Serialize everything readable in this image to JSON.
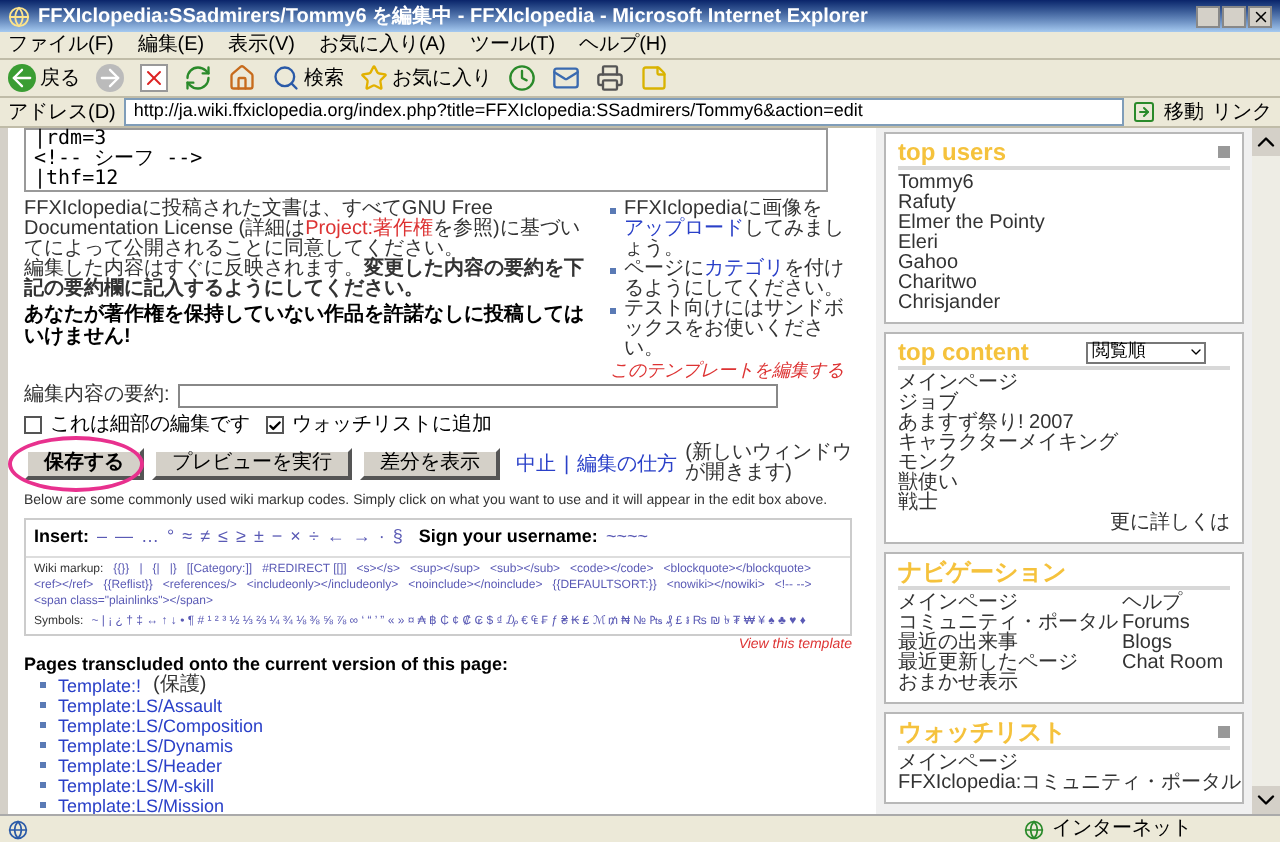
{
  "window": {
    "title": "FFXIclopedia:SSadmirers/Tommy6 を編集中 - FFXIclopedia - Microsoft Internet Explorer"
  },
  "menu": [
    "ファイル(F)",
    "編集(E)",
    "表示(V)",
    "お気に入り(A)",
    "ツール(T)",
    "ヘルプ(H)"
  ],
  "toolbar": {
    "back": "戻る",
    "search": "検索",
    "favorites": "お気に入り"
  },
  "address_bar": {
    "label": "アドレス(D)",
    "url": "http://ja.wiki.ffxiclopedia.org/index.php?title=FFXIclopedia:SSadmirers/Tommy6&action=edit",
    "go": "移動",
    "links": "リンク"
  },
  "editor": {
    "lines": [
      "|rdm=3",
      "<!-- シーフ -->",
      "|thf=12"
    ]
  },
  "notice": {
    "license_before": "FFXIclopediaに投稿された文書は、すべてGNU Free Documentation License (詳細は",
    "license_link": "Project:著作権",
    "license_after": "を参照)に基づいてによって公開されることに同意してください。",
    "publish": "編集した内容はすぐに反映されます。**変更した内容の要約を下記の要約欄に記入するようにしてください。**",
    "warning": "あなたが著作権を保持していない作品を許諾なしに投稿してはいけません!"
  },
  "tips": [
    {
      "before": "FFXIclopediaに画像を",
      "link": "アップロード",
      "after": "してみましょう。"
    },
    {
      "before": "ページに",
      "link": "カテゴリ",
      "after": "を付けるようにしてください。"
    },
    {
      "before": "テスト向けにはサンドボックスをお使いください。"
    }
  ],
  "edit_template_link": "このテンプレートを編集する",
  "summary": {
    "label": "編集内容の要約:"
  },
  "checkboxes": [
    {
      "label": "これは細部の編集です",
      "checked": false
    },
    {
      "label": "ウォッチリストに追加",
      "checked": true
    }
  ],
  "buttons": [
    {
      "label": "保存する",
      "highlighted": true
    },
    {
      "label": "プレビューを実行",
      "highlighted": false
    },
    {
      "label": "差分を表示",
      "highlighted": false
    }
  ],
  "edit_links": {
    "cancel": "中止",
    "separator": "|",
    "help": "編集の仕方",
    "note": "(新しいウィンドウが開きます)"
  },
  "help_text": "Below are some commonly used wiki markup codes. Simply click on what you want to use and it will appear in the edit box above.",
  "insert": {
    "label": "Insert:",
    "chars": [
      "–",
      "—",
      "…",
      "°",
      "≈",
      "≠",
      "≤",
      "≥",
      "±",
      "−",
      "×",
      "÷",
      "←",
      "→",
      "·",
      "§"
    ],
    "sign_label": "Sign your username:",
    "signature": "~~~~"
  },
  "wiki_markup": {
    "label": "Wiki markup:",
    "items": [
      "{{}}",
      "|",
      "{|",
      "|}",
      "[[Category:]]",
      "#REDIRECT [[]]",
      "<s></s>",
      "<sup></sup>",
      "<sub></sub>",
      "<code></code>",
      "<blockquote></blockquote>",
      "<ref></ref>",
      "{{Reflist}}",
      "<references/>",
      "<includeonly></includeonly>",
      "<noinclude></noinclude>",
      "{{DEFAULTSORT:}}",
      "<nowiki></nowiki>",
      "<!-- -->",
      "<span class=\"plainlinks\"></span>"
    ]
  },
  "symbols": {
    "label": "Symbols:",
    "chars": "~ | ¡ ¿ † ‡ ↔ ↑ ↓ • ¶ # ¹ ² ³ ½ ⅓ ⅔ ¼ ¾ ⅛ ⅜ ⅝ ⅞ ∞ ‘ “ ’ ” « » ¤ ₳ ฿ ₵ ¢ ₡ ₢ $ ₫ ₯ € ₠ ₣ ƒ ₴ ₭ ₤ ℳ ₥ ₦ № ₧ ₰ £ ៛ ₨ ₪ ৳ ₮ ₩ ¥ ♠ ♣ ♥ ♦"
  },
  "view_template_link": "View this template",
  "transcluded": {
    "heading": "Pages transcluded onto the current version of this page:",
    "items": [
      {
        "link": "Template:!",
        "note": "(保護)"
      },
      {
        "link": "Template:LS/Assault"
      },
      {
        "link": "Template:LS/Composition"
      },
      {
        "link": "Template:LS/Dynamis"
      },
      {
        "link": "Template:LS/Header"
      },
      {
        "link": "Template:LS/M-skill"
      },
      {
        "link": "Template:LS/Mission"
      }
    ]
  },
  "sidebar": {
    "top_users": {
      "title": "top users",
      "items": [
        "Tommy6",
        "Rafuty",
        "Elmer the Pointy",
        "Eleri",
        "Gahoo",
        "Charitwo",
        "Chrisjander"
      ]
    },
    "top_content": {
      "title": "top content",
      "select": "閲覧順",
      "items": [
        "メインページ",
        "ジョブ",
        "あますず祭り! 2007",
        "キャラクターメイキング",
        "モンク",
        "獣使い",
        "戦士"
      ],
      "more": "更に詳しくは"
    },
    "navigation": {
      "title": "ナビゲーション",
      "left": [
        "メインページ",
        "コミュニティ・ポータル",
        "最近の出来事",
        "最近更新したページ",
        "おまかせ表示"
      ],
      "right": [
        "ヘルプ",
        "Forums",
        "Blogs",
        "Chat Room"
      ]
    },
    "watchlist": {
      "title": "ウォッチリスト",
      "items": [
        "メインページ",
        "FFXIclopedia:コミュニティ・ポータル"
      ]
    }
  },
  "status_bar": {
    "zone": "インターネット"
  }
}
